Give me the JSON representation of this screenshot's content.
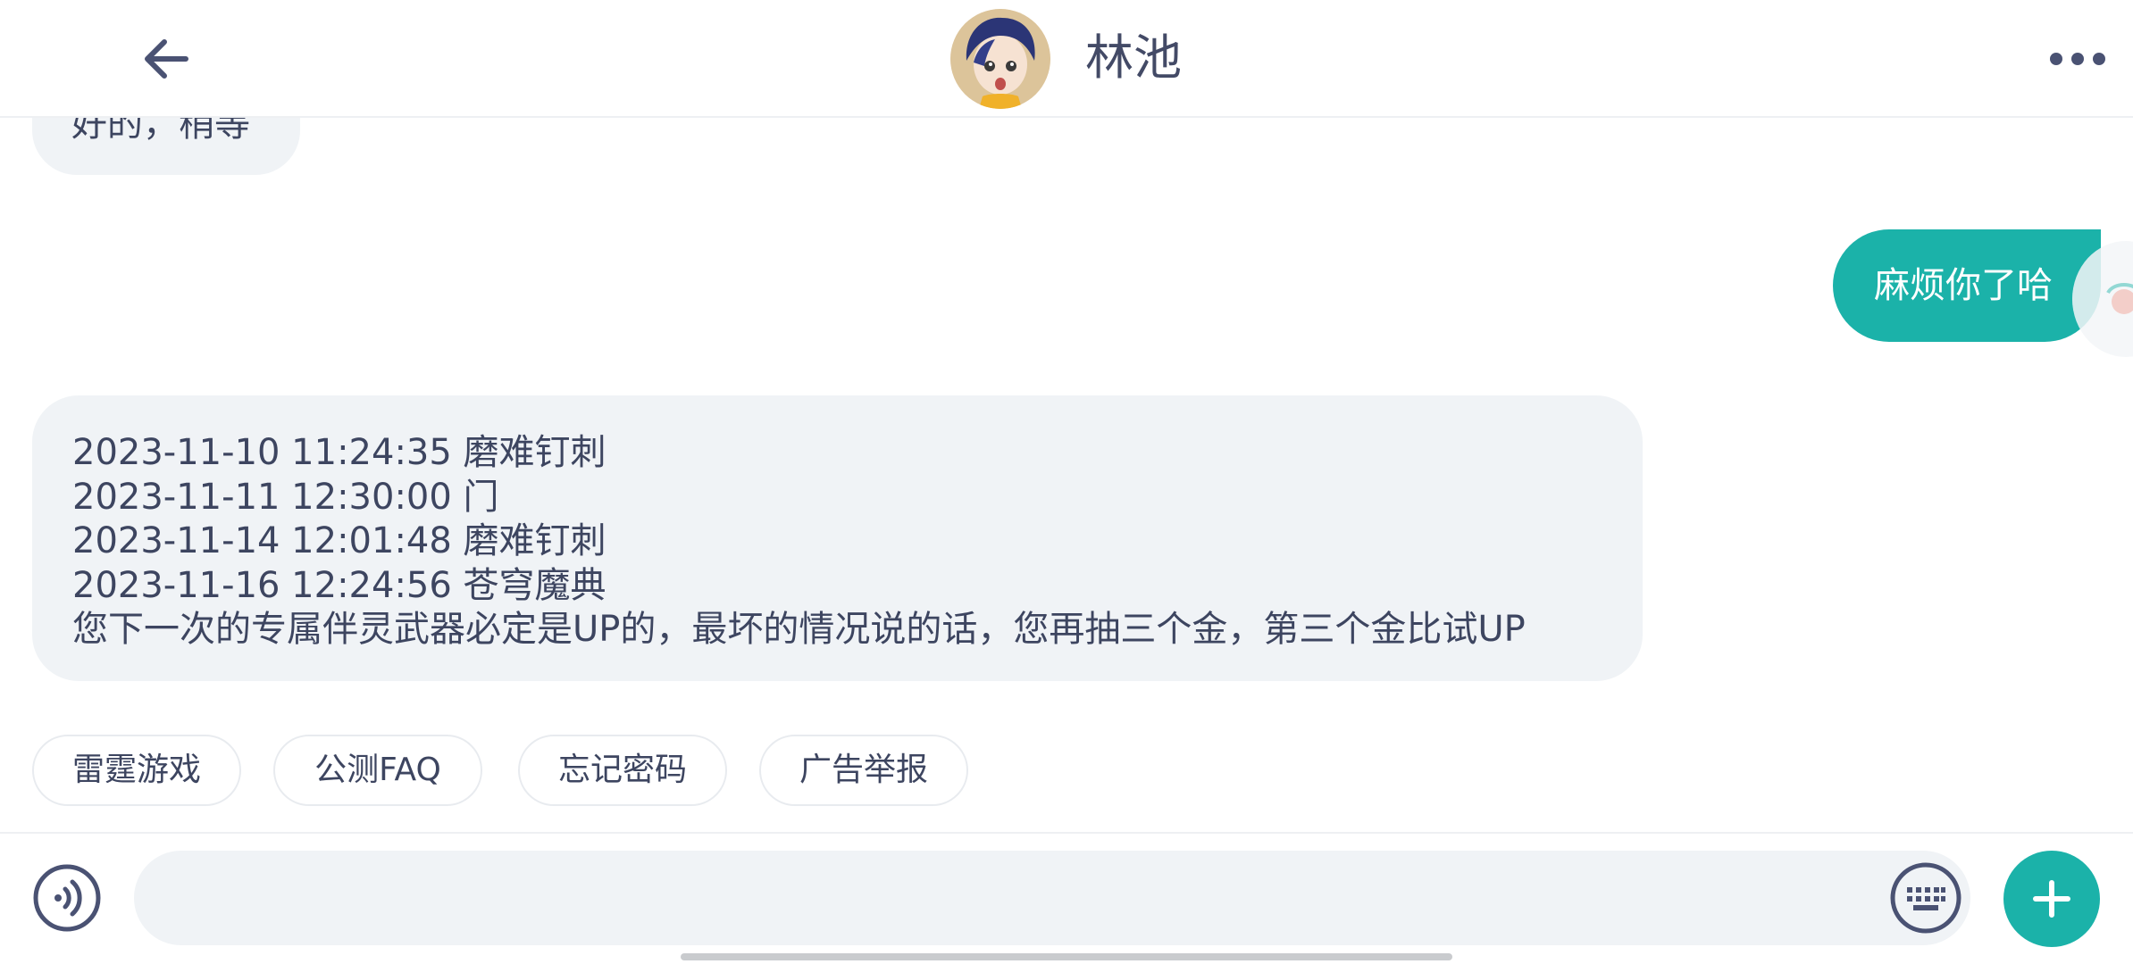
{
  "header": {
    "title": "林池",
    "back_icon": "arrow-left-icon",
    "more_icon": "more-horizontal-icon"
  },
  "messages": {
    "partial_incoming": "好的，稍等",
    "outgoing": "麻烦你了哈",
    "incoming_lines": [
      "2023-11-10 11:24:35 磨难钉刺",
      "2023-11-11 12:30:00 门",
      "2023-11-14 12:01:48 磨难钉刺",
      "2023-11-16 12:24:56 苍穹魔典",
      "您下一次的专属伴灵武器必定是UP的，最坏的情况说的话，您再抽三个金，第三个金比试UP"
    ]
  },
  "quick_replies": [
    "雷霆游戏",
    "公测FAQ",
    "忘记密码",
    "广告举报"
  ],
  "input_bar": {
    "placeholder": "",
    "voice_icon": "voice-icon",
    "keyboard_icon": "keyboard-icon",
    "plus_icon": "plus-icon"
  },
  "colors": {
    "accent": "#1bb2a9",
    "bubble_in": "#f0f3f6",
    "text": "#3d4560"
  }
}
